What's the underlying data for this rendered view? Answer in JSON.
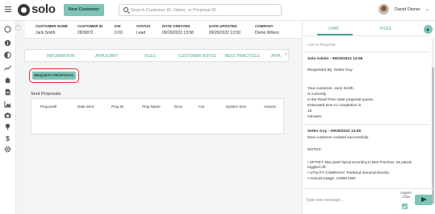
{
  "header": {
    "logo_text": "solo",
    "new_customer_label": "New Customer",
    "search_placeholder": "Search Customer ID, Name, or Proposal ID",
    "user_name": "David Owner"
  },
  "sidebar": {
    "icons": [
      "circle-icon",
      "info-icon",
      "half-circle-icon",
      "trend-icon",
      "home-icon",
      "document-icon",
      "chart-icon",
      "camera-icon",
      "pin-icon",
      "dollar-icon",
      "gear-icon"
    ]
  },
  "customer_info": [
    {
      "label": "CUSTOMER NAME",
      "value": "Jack Smith"
    },
    {
      "label": "CUSTOMER ID",
      "value": "2826872"
    },
    {
      "label": "KW",
      "value": "0.00"
    },
    {
      "label": "STATUS",
      "value": "Lead"
    },
    {
      "label": "DATE CREATED",
      "value": "09/29/2022 13:58"
    },
    {
      "label": "DATE UPDATED",
      "value": "09/29/2022 13:59"
    },
    {
      "label": "COMPANY",
      "value": "Demo Wilson"
    }
  ],
  "tabs": [
    "INFORMATION",
    "APPLICANT",
    "FILES",
    "CUSTOMER NOTES",
    "BEST PRACTICES",
    "APPL"
  ],
  "request_proposal_label": "REQUEST PROPOSAL",
  "sent_proposals": {
    "title": "Sent Proposals",
    "columns": [
      "Proposal#",
      "Date Sent",
      "Prop ID",
      "Prop Name",
      "Docs",
      "Cat",
      "System Size",
      "Actions"
    ]
  },
  "chat": {
    "tabs": [
      "CHAT",
      "FILES"
    ],
    "link_placeholder": "Link to Proposal",
    "messages": [
      {
        "header": "Solo Admin - 09/29/2022 13:58",
        "lines": [
          "Requested By: Setter Guy",
          "",
          "Your customer, Jack Smith,",
          "is currently",
          "in the Real-Time solar proposal queue.",
          "Estimated time to completion is",
          "15",
          "minutes."
        ]
      },
      {
        "header": "Setter Guy - 09/29/2022 13:59",
        "lines": [
          "New customer created successfully.",
          "",
          "NOTES:",
          "",
          "• OFFSET: Max panel layout according to Best Practices, No panels",
          "toggled off.",
          "• UTILITY COMPANY: Portland General Electric",
          "• Annual Usage: 12000 kWh"
        ]
      }
    ],
    "input_placeholder": "Type new message...",
    "urgent_label": "Urgent Chat"
  }
}
